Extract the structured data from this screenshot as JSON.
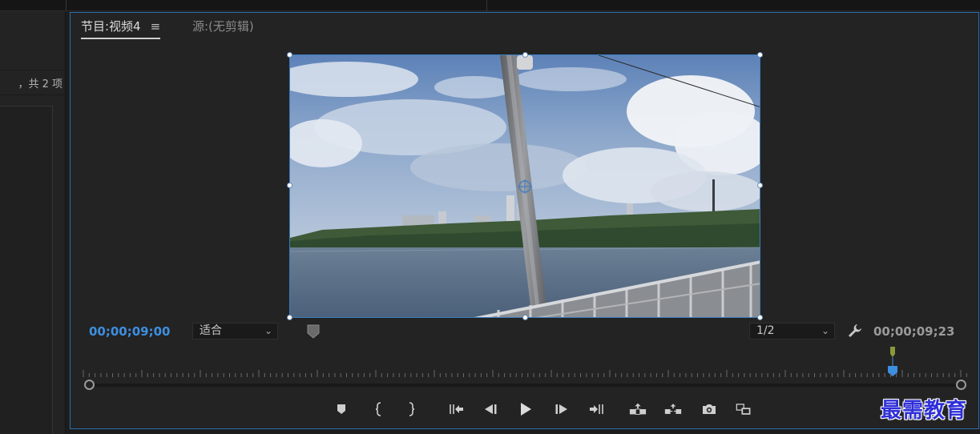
{
  "project_panel": {
    "item_count": "，共 2 项"
  },
  "program_monitor": {
    "tab_program": "节目:视频4",
    "tab_source": "源:(无剪辑)",
    "menu_icon": "≡",
    "timecode_current": "00;00;09;00",
    "zoom_fit": "适合",
    "resolution": "1/2",
    "timecode_duration": "00;00;09;23",
    "accent_color": "#3d8fe0",
    "border_color": "#2d6fb0"
  },
  "transport_controls": [
    {
      "name": "add-marker",
      "icon": "marker-icon"
    },
    {
      "name": "mark-in",
      "icon": "mark-in-icon"
    },
    {
      "name": "mark-out",
      "icon": "mark-out-icon"
    },
    {
      "name": "go-to-in",
      "icon": "go-to-in-icon"
    },
    {
      "name": "step-back",
      "icon": "step-back-icon"
    },
    {
      "name": "play",
      "icon": "play-icon"
    },
    {
      "name": "step-forward",
      "icon": "step-forward-icon"
    },
    {
      "name": "go-to-out",
      "icon": "go-to-out-icon"
    },
    {
      "name": "lift",
      "icon": "lift-icon"
    },
    {
      "name": "extract",
      "icon": "extract-icon"
    },
    {
      "name": "export-frame",
      "icon": "camera-icon"
    },
    {
      "name": "comparison-view",
      "icon": "comparison-icon"
    }
  ],
  "watermark": "最需教育"
}
